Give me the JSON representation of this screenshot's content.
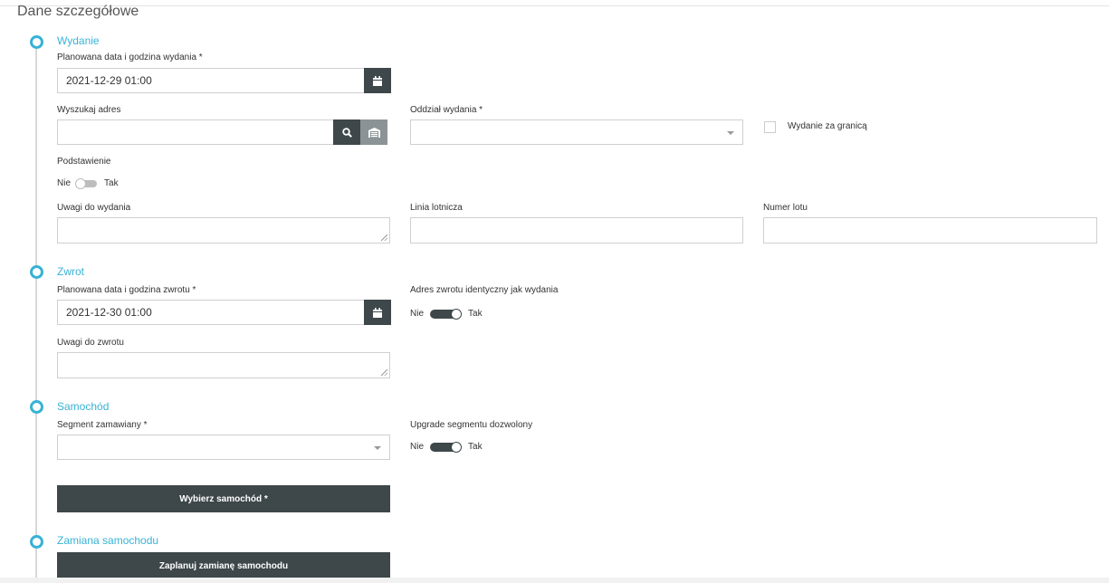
{
  "page_title": "Dane szczegółowe",
  "sections": {
    "wydanie": {
      "title": "Wydanie",
      "date_label": "Planowana data i godzina wydania *",
      "date_value": "2021-12-29 01:00",
      "address_label": "Wyszukaj adres",
      "address_value": "",
      "branch_label": "Oddział wydania *",
      "branch_value": "",
      "abroad_label": "Wydanie za granicą",
      "abroad_checked": false,
      "substitution_label": "Podstawienie",
      "substitution": {
        "off_label": "Nie",
        "on_label": "Tak",
        "value": false
      },
      "notes_label": "Uwagi do wydania",
      "airline_label": "Linia lotnicza",
      "flight_label": "Numer lotu"
    },
    "zwrot": {
      "title": "Zwrot",
      "date_label": "Planowana data i godzina zwrotu *",
      "date_value": "2021-12-30 01:00",
      "same_address_label": "Adres zwrotu identyczny jak wydania",
      "same_address": {
        "off_label": "Nie",
        "on_label": "Tak",
        "value": true
      },
      "notes_label": "Uwagi do zwrotu"
    },
    "samochod": {
      "title": "Samochód",
      "segment_label": "Segment zamawiany *",
      "segment_value": "",
      "upgrade_label": "Upgrade segmentu dozwolony",
      "upgrade": {
        "off_label": "Nie",
        "on_label": "Tak",
        "value": true
      },
      "choose_button": "Wybierz samochód *"
    },
    "zamiana": {
      "title": "Zamiana samochodu",
      "plan_button": "Zaplanuj zamianę samochodu"
    }
  },
  "icons": {
    "calendar": "calendar-icon",
    "search": "search-icon",
    "garage": "garage-icon"
  },
  "colors": {
    "accent": "#38b2d6",
    "dark": "#3e474a"
  }
}
